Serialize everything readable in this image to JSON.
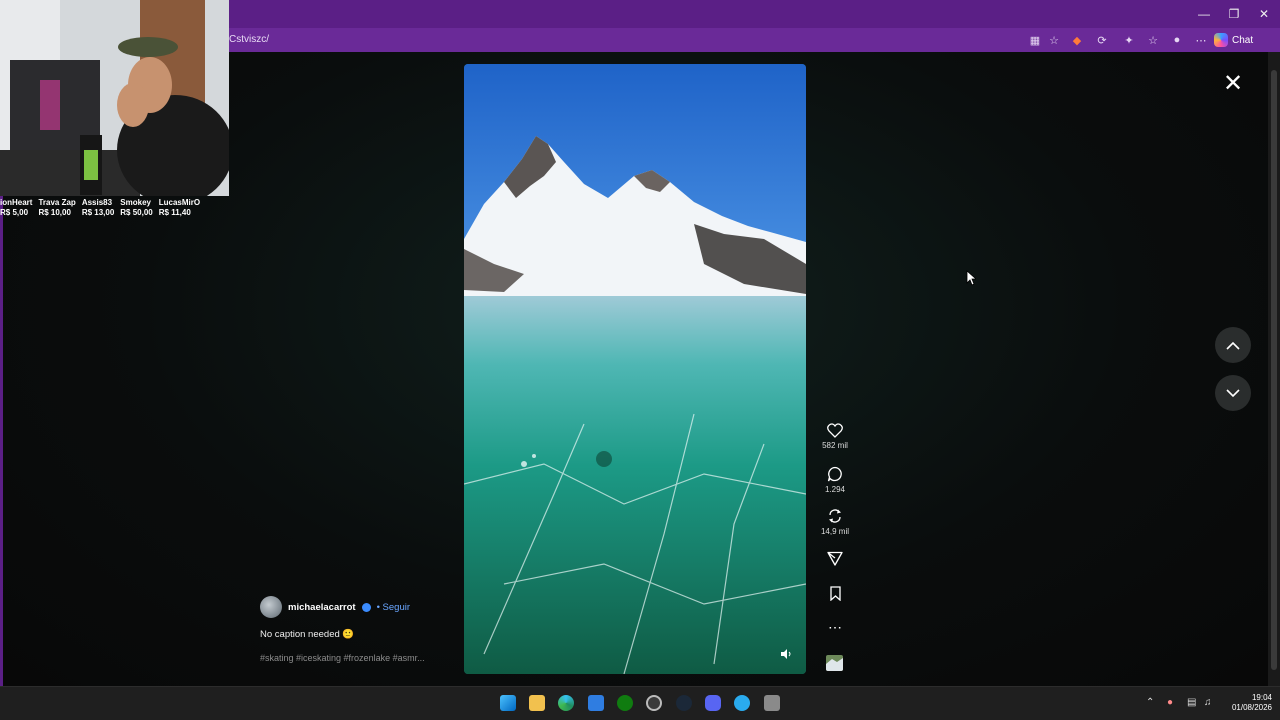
{
  "browser": {
    "url": "Cstviszc/",
    "chat_label": "Chat"
  },
  "stream_overlay": {
    "donations": [
      {
        "name": "ionHeart",
        "amount": "R$ 5,00"
      },
      {
        "name": "Trava Zap",
        "amount": "R$ 10,00"
      },
      {
        "name": "Assis83",
        "amount": "R$ 13,00"
      },
      {
        "name": "Smokey",
        "amount": "R$ 50,00"
      },
      {
        "name": "LucasMirO",
        "amount": "R$ 11,40"
      }
    ]
  },
  "post": {
    "username": "michaelacarrot",
    "follow_label": "• Seguir",
    "caption": "No caption needed 🙂",
    "hashtags": "#skating #iceskating #frozenlake #asmr...",
    "likes": "582 mil",
    "comments": "1.294",
    "reposts": "14,9 mil"
  },
  "taskbar": {
    "time": "19:04",
    "date": "01/08/2026"
  },
  "icons": {
    "like": "heart-icon",
    "comment": "comment-icon",
    "repost": "repost-icon",
    "share": "share-icon",
    "save": "bookmark-icon",
    "more": "more-icon",
    "close": "close-icon",
    "prev": "chevron-up-icon",
    "next": "chevron-down-icon"
  },
  "colors": {
    "browser_frame": "#5b1f86",
    "follow_link": "#6aa6ff",
    "verified": "#3b8cff"
  }
}
